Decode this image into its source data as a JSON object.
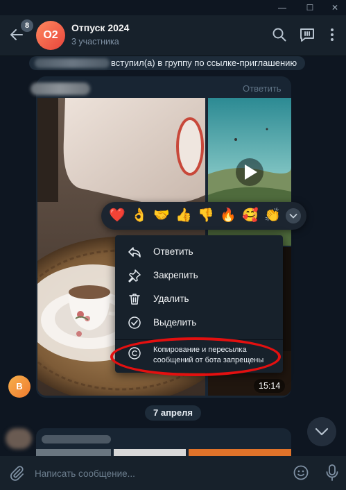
{
  "window": {
    "minimize": "—",
    "maximize": "☐",
    "close": "✕"
  },
  "header": {
    "unread_count": "8",
    "avatar_initials": "O2",
    "title": "Отпуск 2024",
    "subtitle": "3 участника"
  },
  "chat": {
    "service_message": "вступил(а) в группу по ссылке-приглашению",
    "reply_label": "Ответить",
    "message_time": "15:14",
    "sender_avatar_initial": "B",
    "date_separator": "7 апреля"
  },
  "reactions": [
    "❤️",
    "👌",
    "🤝",
    "👍",
    "👎",
    "🔥",
    "🥰",
    "👏"
  ],
  "context_menu": {
    "items": [
      {
        "label": "Ответить",
        "icon": "reply-icon"
      },
      {
        "label": "Закрепить",
        "icon": "pin-icon"
      },
      {
        "label": "Удалить",
        "icon": "trash-icon"
      },
      {
        "label": "Выделить",
        "icon": "check-circle-icon"
      }
    ],
    "note": "Копирование и пересылка сообщений от бота запрещены",
    "note_icon": "copyright-icon"
  },
  "composer": {
    "placeholder": "Написать сообщение..."
  },
  "colors": {
    "background": "#0e1621",
    "panel": "#17212b",
    "bubble": "#182533",
    "accent_avatar": "#e8453c",
    "annotation_ring": "#e31010"
  }
}
